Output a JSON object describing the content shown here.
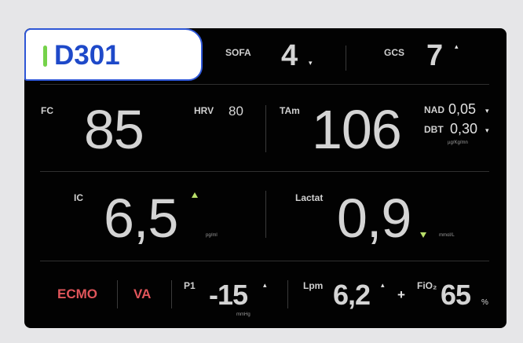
{
  "header": {
    "room_id": "D301",
    "sofa_label": "SOFA",
    "sofa_value": "4",
    "sofa_trend": "down",
    "gcs_label": "GCS",
    "gcs_value": "7",
    "gcs_trend": "up"
  },
  "row1": {
    "fc_label": "FC",
    "fc_value": "85",
    "hrv_label": "HRV",
    "hrv_value": "80",
    "tam_label": "TAm",
    "tam_value": "106",
    "nad_label": "NAD",
    "nad_value": "0,05",
    "dbt_label": "DBT",
    "dbt_value": "0,30",
    "drug_unit": "µg/Kg/mn"
  },
  "row2": {
    "ic_label": "IC",
    "ic_value": "6,5",
    "ic_unit": "pg/ml",
    "lactat_label": "Lactat",
    "lactat_value": "0,9",
    "lactat_unit": "mmol/L"
  },
  "row3": {
    "ecmo_label": "ECMO",
    "va_label": "VA",
    "p1_label": "P1",
    "p1_value": "-15",
    "p1_unit": "mmHg",
    "lpm_label": "Lpm",
    "lpm_value": "6,2",
    "plus": "+",
    "fio2_label": "FiO₂",
    "fio2_value": "65",
    "fio2_unit": "%"
  },
  "colors": {
    "panel": "#020202",
    "room_accent": "#1e49c9",
    "room_bar": "#75d24a",
    "trend_green": "#b9e06a",
    "alert_red": "#e0555a"
  },
  "icons": {
    "room_status": "status-bar-icon",
    "trend_up": "trend-up-icon",
    "trend_down": "trend-down-icon"
  }
}
